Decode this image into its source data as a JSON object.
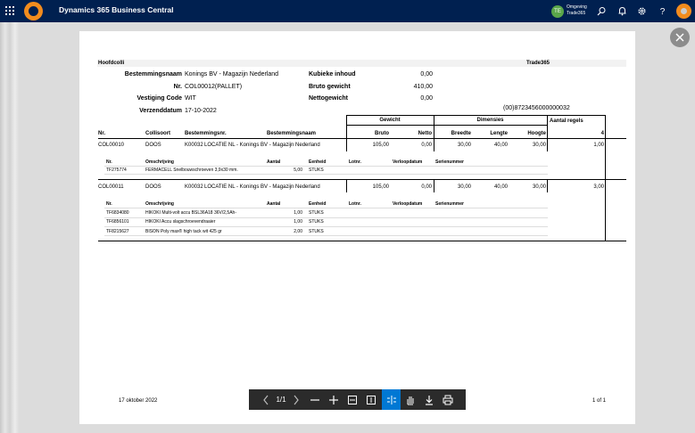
{
  "app": {
    "title": "Dynamics 365 Business Central",
    "environment_label": "Omgeving",
    "environment_name": "Trade365",
    "environment_initials": "TE"
  },
  "icons": {
    "waffle": "waffle-icon",
    "search": "search-icon",
    "bell": "bell-icon",
    "settings": "gear-icon",
    "help": "help-icon",
    "close": "close-icon"
  },
  "report": {
    "title": "Hoofdcolli",
    "company": "Trade365",
    "header": {
      "bestemmingsnaam_label": "Bestemmingsnaam",
      "bestemmingsnaam_value": "Konings BV - Magazijn Nederland",
      "nr_label": "Nr.",
      "nr_value": "COL00012(PALLET)",
      "vestiging_label": "Vestiging Code",
      "vestiging_value": "WIT",
      "verzenddatum_label": "Verzenddatum",
      "verzenddatum_value": "17-10-2022",
      "kubieke_label": "Kubieke inhoud",
      "kubieke_value": "0,00",
      "bruto_label": "Bruto gewicht",
      "bruto_value": "410,00",
      "netto_label": "Nettogewicht",
      "netto_value": "0,00",
      "barcode": "(00)8723456000000032"
    },
    "groups": {
      "gewicht": "Gewicht",
      "dimensies": "Dimensies",
      "aantal_regels": "Aantal regels"
    },
    "columns": {
      "nr": "Nr.",
      "collisoort": "Collisoort",
      "bestemmingsnr": "Bestemmingsnr.",
      "bestemmingsnaam": "Bestemmingsnaam",
      "bruto": "Bruto",
      "netto": "Netto",
      "breedte": "Breedte",
      "lengte": "Lengte",
      "hoogte": "Hoogte",
      "aantal_total": "4"
    },
    "sub_columns": {
      "nr": "Nr.",
      "omschrijving": "Omschrijving",
      "aantal": "Aantal",
      "eenheid": "Eenheid",
      "lotnr": "Lotnr.",
      "verloopdatum": "Verloopdatum",
      "serienummer": "Serienummer"
    },
    "collis": [
      {
        "nr": "COL00010",
        "soort": "DOOS",
        "bestemmingsnr": "K00032",
        "bestemmingsnaam": "LOCATIE NL - Konings BV - Magazijn Nederland",
        "bruto": "105,00",
        "netto": "0,00",
        "breedte": "30,00",
        "lengte": "40,00",
        "hoogte": "30,00",
        "aantal": "1,00",
        "lines": [
          {
            "nr": "TF275774",
            "omschrijving": "FERMACELL Snelbouwschroeven 3,9x30 mm.",
            "aantal": "5,00",
            "eenheid": "STUKS"
          }
        ]
      },
      {
        "nr": "COL00011",
        "soort": "DOOS",
        "bestemmingsnr": "K00032",
        "bestemmingsnaam": "LOCATIE NL - Konings BV - Magazijn Nederland",
        "bruto": "105,00",
        "netto": "0,00",
        "breedte": "30,00",
        "lengte": "40,00",
        "hoogte": "30,00",
        "aantal": "3,00",
        "lines": [
          {
            "nr": "TF6834080",
            "omschrijving": "HIKOKI Multi-volt accu BSL36A18 36V/2,5Ah-",
            "aantal": "1,00",
            "eenheid": "STUKS"
          },
          {
            "nr": "TF6856101",
            "omschrijving": "HIKOKI Accu slagschroevendraaier",
            "aantal": "1,00",
            "eenheid": "STUKS"
          },
          {
            "nr": "TF8215627",
            "omschrijving": "BISON Poly max® high tack wit 425 gr",
            "aantal": "2,00",
            "eenheid": "STUKS"
          }
        ]
      }
    ],
    "footer_date": "17 oktober 2022",
    "footer_page": "1 of 1"
  },
  "viewer": {
    "page_indicator": "1/1"
  }
}
